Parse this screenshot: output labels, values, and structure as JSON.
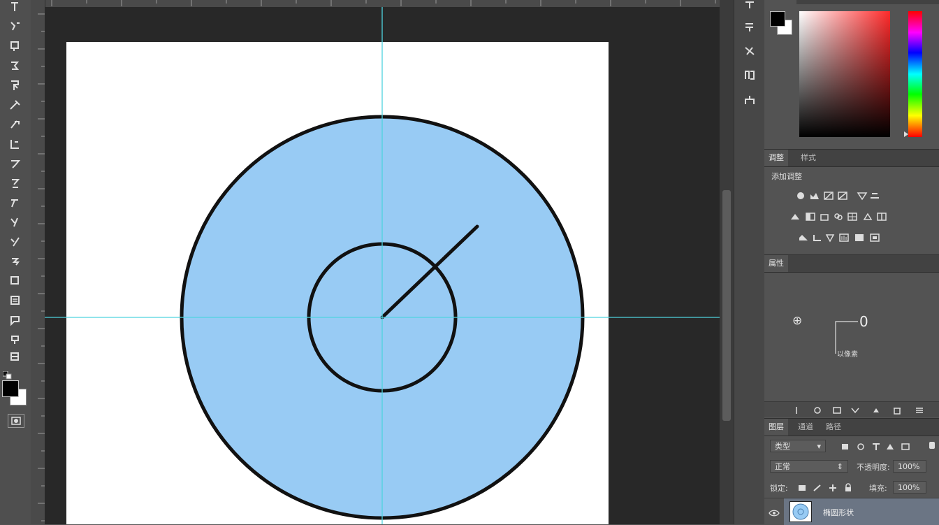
{
  "colors": {
    "fill": "#98cbf4",
    "guide": "#4fd3df",
    "stroke": "#111111",
    "selected_layer": "#6b7584"
  },
  "toolbar": {
    "tools": [
      "move-icon",
      "marquee-icon",
      "lasso-icon",
      "quick-select-icon",
      "crop-icon",
      "eyedropper-icon",
      "healing-icon",
      "brush-icon",
      "clone-stamp-icon",
      "history-brush-icon",
      "eraser-icon",
      "gradient-icon",
      "blur-icon",
      "dodge-icon",
      "pen-icon",
      "type-icon",
      "path-select-icon",
      "shape-icon",
      "hand-icon",
      "zoom-icon"
    ],
    "foreground": "#000000",
    "background": "#ffffff"
  },
  "dock": {
    "items": [
      "history-icon",
      "properties-icon",
      "brush-presets-icon",
      "character-icon",
      "paragraph-icon"
    ]
  },
  "panels": {
    "color": {
      "tab_labels": [
        "",
        ""
      ]
    },
    "adjustments": {
      "tabs": [
        "调整",
        "样式"
      ],
      "title": "添加调整"
    },
    "properties": {
      "tab": "属性",
      "angle_symbol": "⊕",
      "angle_value": "0",
      "caption": "以像素"
    },
    "layers": {
      "tabs": [
        "图层",
        "通道",
        "路径"
      ],
      "filter_label": "类型",
      "blend_mode": "正常",
      "opacity_label": "不透明度:",
      "opacity_value": "100%",
      "lock_label": "锁定:",
      "fill_label": "填充:",
      "fill_value": "100%",
      "layer_name": "椭圆形状"
    }
  }
}
